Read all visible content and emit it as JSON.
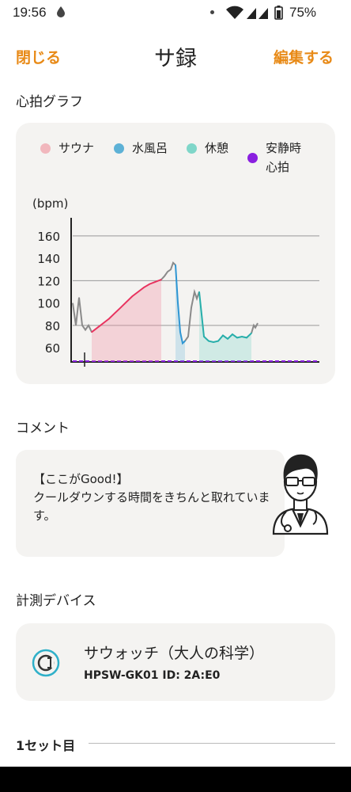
{
  "status_bar": {
    "time": "19:56",
    "battery": "75%"
  },
  "header": {
    "close_label": "閉じる",
    "title": "サ録",
    "edit_label": "編集する"
  },
  "heart_rate_section": {
    "label": "心拍グラフ"
  },
  "legend": [
    {
      "label": "サウナ",
      "color": "#f1b7bd"
    },
    {
      "label": "水風呂",
      "color": "#5db1d6"
    },
    {
      "label": "休憩",
      "color": "#7fd6c9"
    },
    {
      "label": "安静時",
      "label2": "心拍",
      "color": "#8a1fe0"
    }
  ],
  "chart_data": {
    "type": "line",
    "ylabel": "(bpm)",
    "yticks": [
      60,
      80,
      100,
      120,
      140,
      160
    ],
    "ylim": [
      48,
      172
    ],
    "grid_lines": [
      80,
      120,
      160
    ],
    "resting_line": 49,
    "series": [
      {
        "phase": "sauna",
        "color": "#e8335f",
        "values": [
          74,
          78,
          82,
          86,
          91,
          96,
          101,
          106,
          110,
          114,
          117,
          119,
          121
        ]
      },
      {
        "phase": "cold-bath",
        "color": "#2f96d3",
        "values": [
          134,
          100,
          74,
          64,
          66
        ]
      },
      {
        "phase": "rest",
        "color": "#27aeaa",
        "values": [
          110,
          70,
          66,
          65,
          66,
          71,
          68,
          72,
          69,
          70,
          69,
          73
        ]
      }
    ]
  },
  "comment_section": {
    "label": "コメント",
    "title": "【ここがGood!】",
    "body": "クールダウンする時間をきちんと取れています。"
  },
  "device_section": {
    "label": "計測デバイス",
    "name": "サウォッチ（大人の科学）",
    "id": "HPSW-GK01   ID: 2A:E0"
  },
  "set_section": {
    "label": "1セット目"
  }
}
